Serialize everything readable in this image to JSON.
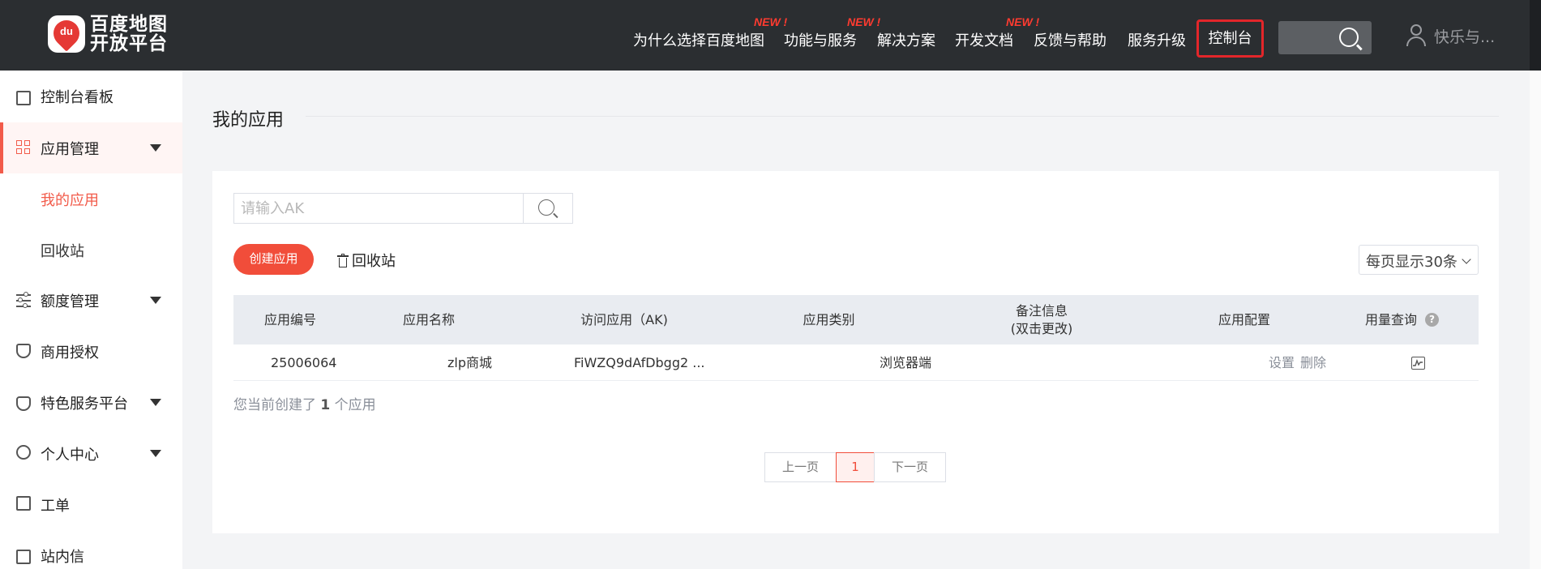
{
  "header": {
    "logo_line1": "百度地图",
    "logo_line2": "开放平台",
    "logo_badge": "du",
    "nav": [
      {
        "label": "为什么选择百度地图",
        "badge": ""
      },
      {
        "label": "功能与服务",
        "badge": "NEW !"
      },
      {
        "label": "解决方案",
        "badge": "NEW !"
      },
      {
        "label": "开发文档",
        "badge": "NEW !"
      },
      {
        "label": "反馈与帮助",
        "badge": ""
      },
      {
        "label": "服务升级",
        "badge": ""
      }
    ],
    "console_label": "控制台",
    "user_name": "快乐与..."
  },
  "sidebar": {
    "items": [
      {
        "label": "控制台看板",
        "icon": "dashboard-card-icon"
      },
      {
        "label": "应用管理",
        "icon": "grid-icon",
        "expanded": true
      },
      {
        "label": "额度管理",
        "icon": "sliders-icon"
      },
      {
        "label": "商用授权",
        "icon": "shield-icon"
      },
      {
        "label": "特色服务平台",
        "icon": "diamond-icon"
      },
      {
        "label": "个人中心",
        "icon": "person-icon"
      },
      {
        "label": "工单",
        "icon": "clipboard-icon"
      },
      {
        "label": "站内信",
        "icon": "mail-icon"
      }
    ],
    "sub_items": [
      {
        "label": "我的应用",
        "active": true
      },
      {
        "label": "回收站",
        "active": false
      }
    ]
  },
  "main": {
    "page_title": "我的应用",
    "search_placeholder": "请输入AK",
    "create_button": "创建应用",
    "recycle_button": "回收站",
    "per_page": "每页显示30条",
    "table": {
      "headers": [
        "应用编号",
        "应用名称",
        "访问应用（AK)",
        "应用类别",
        "备注信息",
        "(双击更改)",
        "应用配置",
        "用量查询"
      ],
      "rows": [
        {
          "id": "25006064",
          "name": "zlp商城",
          "ak": "FiWZQ9dAfDbgg2 ...",
          "category": "浏览器端",
          "remark": "",
          "settings": "设置",
          "delete": "删除"
        }
      ]
    },
    "count_prefix": "您当前创建了",
    "count_value": "1",
    "count_suffix": "个应用",
    "pagination": {
      "prev": "上一页",
      "current": "1",
      "next": "下一页"
    }
  },
  "colors": {
    "topbar": "#2b2e31",
    "accent": "#f14d3a",
    "new_badge": "#ff3b30",
    "console_border": "#e3262a"
  }
}
